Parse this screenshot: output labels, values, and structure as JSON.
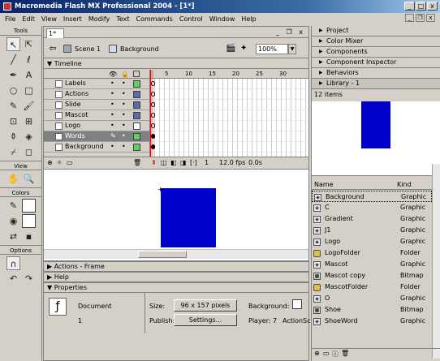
{
  "app": {
    "title": "Macromedia Flash MX Professional 2004 - [1*]"
  },
  "window_controls": {
    "minimize": "_",
    "maximize": "□",
    "close": "x"
  },
  "doc_controls": {
    "minimize": "_",
    "restore": "❐",
    "close": "x"
  },
  "menu": [
    "File",
    "Edit",
    "View",
    "Insert",
    "Modify",
    "Text",
    "Commands",
    "Control",
    "Window",
    "Help"
  ],
  "tools": {
    "header": "Tools",
    "view_header": "View",
    "colors_header": "Colors",
    "options_header": "Options"
  },
  "document": {
    "tab": "1*",
    "scene": "Scene 1",
    "symbol": "Background",
    "zoom": "100%"
  },
  "timeline": {
    "label": "Timeline",
    "frame_numbers": [
      "5",
      "10",
      "15",
      "20",
      "25",
      "30"
    ],
    "layers": [
      {
        "name": "Labels",
        "color": "#66cc66"
      },
      {
        "name": "Actions",
        "color": "#5a6bb0"
      },
      {
        "name": "Slide",
        "color": "#5a6bb0"
      },
      {
        "name": "Mascot",
        "color": "#5a6bb0"
      },
      {
        "name": "Logo",
        "color": "#ffffff"
      },
      {
        "name": "Words",
        "color": "#66cc66"
      },
      {
        "name": "Background",
        "color": "#66cc66"
      }
    ],
    "current_frame": "1",
    "fps": "12.0 fps",
    "elapsed": "0.0s"
  },
  "panels": {
    "actions": "Actions - Frame",
    "help": "Help",
    "properties": "Properties"
  },
  "properties": {
    "type": "Document",
    "name": "1",
    "size_label": "Size:",
    "size_value": "96 x 157 pixels",
    "publish_label": "Publish:",
    "settings_button": "Settings...",
    "background_label": "Background:",
    "player_label": "Player: 7",
    "actionscript_label": "ActionSc"
  },
  "right_panels": [
    "Project",
    "Color Mixer",
    "Components",
    "Component Inspector",
    "Behaviors"
  ],
  "library": {
    "title": "Library - 1",
    "count": "12 items",
    "col_name": "Name",
    "col_kind": "Kind",
    "items": [
      {
        "name": "Background",
        "kind": "Graphic"
      },
      {
        "name": "C",
        "kind": "Graphic"
      },
      {
        "name": "Gradient",
        "kind": "Graphic"
      },
      {
        "name": "J1",
        "kind": "Graphic"
      },
      {
        "name": "Logo",
        "kind": "Graphic"
      },
      {
        "name": "LogoFolder",
        "kind": "Folder"
      },
      {
        "name": "Mascot",
        "kind": "Graphic"
      },
      {
        "name": "Mascot copy",
        "kind": "Bitmap"
      },
      {
        "name": "MascotFolder",
        "kind": "Folder"
      },
      {
        "name": "O",
        "kind": "Graphic"
      },
      {
        "name": "Shoe",
        "kind": "Bitmap"
      },
      {
        "name": "ShoeWord",
        "kind": "Graphic"
      }
    ]
  },
  "colors": {
    "accent": "#0000cc",
    "title_start": "#0a246a"
  }
}
